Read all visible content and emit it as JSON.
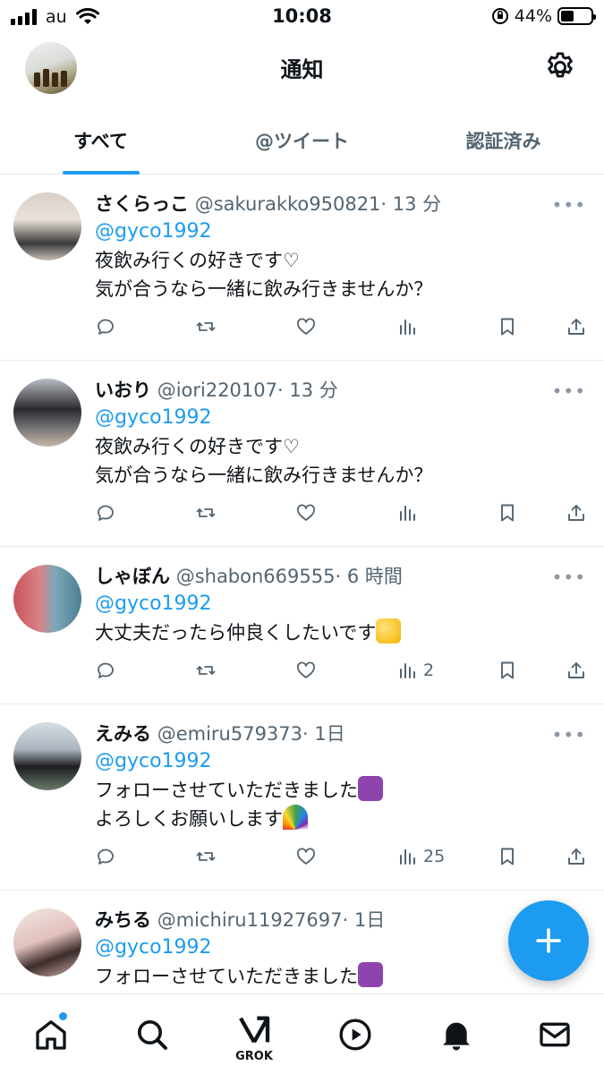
{
  "status_bar": {
    "carrier": "au",
    "time": "10:08",
    "battery": "44%",
    "battery_level": 0.44
  },
  "header": {
    "title": "通知"
  },
  "tabs": [
    {
      "label": "すべて",
      "active": true
    },
    {
      "label": "@ツイート",
      "active": false
    },
    {
      "label": "認証済み",
      "active": false
    }
  ],
  "tweets": [
    {
      "name": "さくらっこ",
      "handle": "@sakurakko950821",
      "time": "· 13 分",
      "mention": "@gyco1992",
      "lines": [
        "夜飲み行くの好きです♡",
        "気が合うなら一緒に飲み行きませんか？"
      ],
      "views": ""
    },
    {
      "name": "いおり",
      "handle": "@iori220107",
      "time": "· 13 分",
      "mention": "@gyco1992",
      "lines": [
        "夜飲み行くの好きです♡",
        "気が合うなら一緒に飲み行きませんか？"
      ],
      "views": ""
    },
    {
      "name": "しゃぼん",
      "handle": "@shabon669555",
      "time": "· 6 時間",
      "mention": "@gyco1992",
      "lines": [
        "大丈夫だったら仲良くしたいです"
      ],
      "views": "2"
    },
    {
      "name": "えみる",
      "handle": "@emiru579373",
      "time": "· 1日",
      "mention": "@gyco1992",
      "lines": [
        "フォローさせていただきました",
        "よろしくお願いします"
      ],
      "views": "25"
    },
    {
      "name": "みちる",
      "handle": "@michiru11927697",
      "time": "· 1日",
      "mention": "@gyco1992",
      "lines": [
        "フォローさせていただきました"
      ],
      "views": ""
    }
  ],
  "bottom_nav": {
    "grok_label": "GROK"
  },
  "icons": {
    "reply": "reply-icon",
    "retweet": "retweet-icon",
    "like": "heart-icon",
    "views": "views-icon",
    "bookmark": "bookmark-icon",
    "share": "share-icon",
    "settings": "gear-icon",
    "compose": "plus-icon"
  },
  "colors": {
    "accent": "#1d9bf0",
    "text": "#0f1419",
    "muted": "#536471"
  }
}
